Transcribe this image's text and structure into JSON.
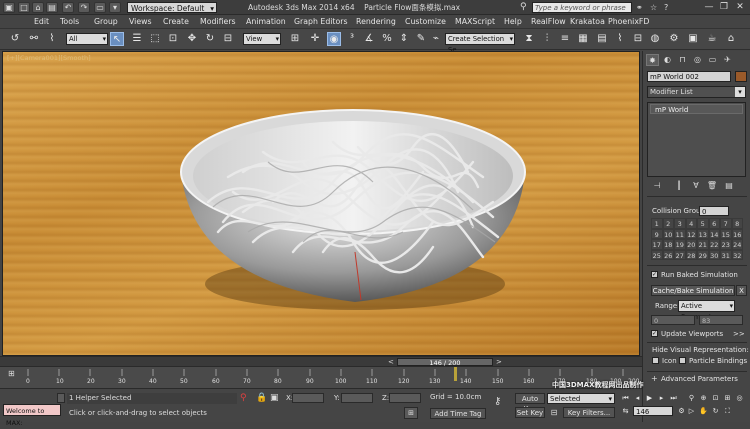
{
  "title_bar": {
    "workspace_label": "Workspace: Default",
    "app_title": "Autodesk 3ds Max  2014 x64",
    "file_title": "Particle Flow面条模拟.max",
    "search_placeholder": "Type a keyword or phrase",
    "window_buttons": [
      "—",
      "❐",
      "✕"
    ]
  },
  "menu": [
    "Edit",
    "Tools",
    "Group",
    "Views",
    "Create",
    "Modifiers",
    "Animation",
    "Graph Editors",
    "Rendering",
    "Customize",
    "MAXScript",
    "Help",
    "RealFlow",
    "Krakatoa",
    "PhoenixFD"
  ],
  "toolbar": {
    "selection_filter": "All",
    "ref_coord": "View",
    "named_selection": "Create Selection Se"
  },
  "viewport": {
    "label": "[+][Camera001][Smooth]"
  },
  "command_panel": {
    "object_name": "mP World 002",
    "object_color": "#9a5a2a",
    "modifier_list": "Modifier List",
    "stack_items": [
      "mP World"
    ],
    "collision_group_label": "Collision Group:",
    "collision_group_value": "0",
    "collision_grid": [
      "1",
      "2",
      "3",
      "4",
      "5",
      "6",
      "7",
      "8",
      "9",
      "10",
      "11",
      "12",
      "13",
      "14",
      "15",
      "16",
      "17",
      "18",
      "19",
      "20",
      "21",
      "22",
      "23",
      "24",
      "25",
      "26",
      "27",
      "28",
      "29",
      "30",
      "31",
      "32"
    ],
    "run_baked_label": "Run Baked Simulation",
    "cache_button": "Cache/Bake Simulation",
    "cache_x": "X",
    "range_label": "Range:",
    "range_value": "Active Segment",
    "range_start": "0",
    "range_end": "83",
    "update_viewports_label": "Update Viewports",
    "update_arrow": ">>",
    "hide_visual_label": "Hide Visual Representation:",
    "icon_label": "Icon",
    "particle_bindings_label": "Particle Bindings",
    "advanced_params_label": "Advanced Parameters"
  },
  "timeline": {
    "frame_display": "146 / 200",
    "ticks": [
      "0",
      "10",
      "20",
      "30",
      "40",
      "50",
      "60",
      "70",
      "80",
      "90",
      "100",
      "110",
      "120",
      "130",
      "140",
      "150",
      "160",
      "170",
      "180",
      "190",
      "200"
    ]
  },
  "status": {
    "maxscript_label": "Welcome to MAX:",
    "selection_info": "1 Helper Selected",
    "prompt": "Click or click-and-drag to select objects",
    "x_label": "X:",
    "y_label": "Y:",
    "z_label": "Z:",
    "grid": "Grid = 10.0cm",
    "add_time_tag": "Add Time Tag",
    "auto_key": "Auto Key",
    "set_key": "Set Key",
    "key_mode": "Selected",
    "key_filters": "Key Filters...",
    "current_frame": "146"
  },
  "watermark": "中国3DMAX教程网出品制作"
}
